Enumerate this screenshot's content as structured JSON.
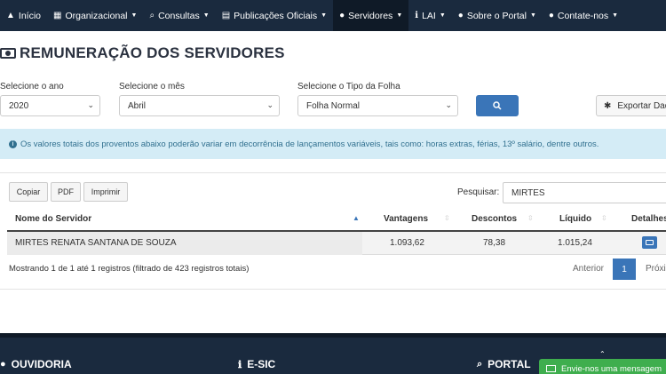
{
  "nav": {
    "items": [
      {
        "label": "Início",
        "icon": "home-icon",
        "glyph": "▲"
      },
      {
        "label": "Organizacional",
        "icon": "building-icon",
        "glyph": "▦",
        "caret": "▼"
      },
      {
        "label": "Consultas",
        "icon": "search-icon",
        "glyph": "⌕",
        "caret": "▼"
      },
      {
        "label": "Publicações Oficiais",
        "icon": "newspaper-icon",
        "glyph": "▤",
        "caret": "▼"
      },
      {
        "label": "Servidores",
        "icon": "user-icon",
        "glyph": "●",
        "caret": "▼"
      },
      {
        "label": "LAI",
        "icon": "info-icon",
        "glyph": "ℹ",
        "caret": "▼"
      },
      {
        "label": "Sobre o Portal",
        "icon": "info-circle-icon",
        "glyph": "●",
        "caret": "▼"
      },
      {
        "label": "Contate-nos",
        "icon": "comment-icon",
        "glyph": "●",
        "caret": "▼"
      }
    ]
  },
  "page": {
    "title": "REMUNERAÇÃO DOS SERVIDORES"
  },
  "filters": {
    "year_label": "Selecione o ano",
    "year_value": "2020",
    "month_label": "Selecione o mês",
    "month_value": "Abril",
    "type_label": "Selecione o Tipo da Folha",
    "type_value": "Folha Normal",
    "export_label": "Exportar Dad"
  },
  "alert": {
    "text": "Os valores totais dos proventos abaixo poderão variar em decorrência de lançamentos variáveis, tais como: horas extras, férias, 13º salário, dentre outros."
  },
  "toolbar": {
    "copy": "Copiar",
    "pdf": "PDF",
    "print": "Imprimir",
    "search_label": "Pesquisar:",
    "search_value": "MIRTES"
  },
  "table": {
    "headers": {
      "name": "Nome do Servidor",
      "vantagens": "Vantagens",
      "descontos": "Descontos",
      "liquido": "Líquido",
      "detalhes": "Detalhes"
    },
    "rows": [
      {
        "name": "MIRTES RENATA SANTANA DE SOUZA",
        "vantagens": "1.093,62",
        "descontos": "78,38",
        "liquido": "1.015,24"
      }
    ]
  },
  "pagination": {
    "info": "Mostrando 1 de 1 até 1 registros (filtrado de 423 registros totais)",
    "prev": "Anterior",
    "page": "1",
    "next": "Próxi"
  },
  "footer": {
    "ouvidoria": "OUVIDORIA",
    "esic": "E-SIC",
    "portal": "PORTAL"
  },
  "chat": {
    "text": "Envie-nos uma mensagem"
  },
  "colors": {
    "navbar": "#1a2a3e",
    "primary": "#3a75b8",
    "alert_bg": "#d4ecf6",
    "chat": "#3fae4e"
  }
}
